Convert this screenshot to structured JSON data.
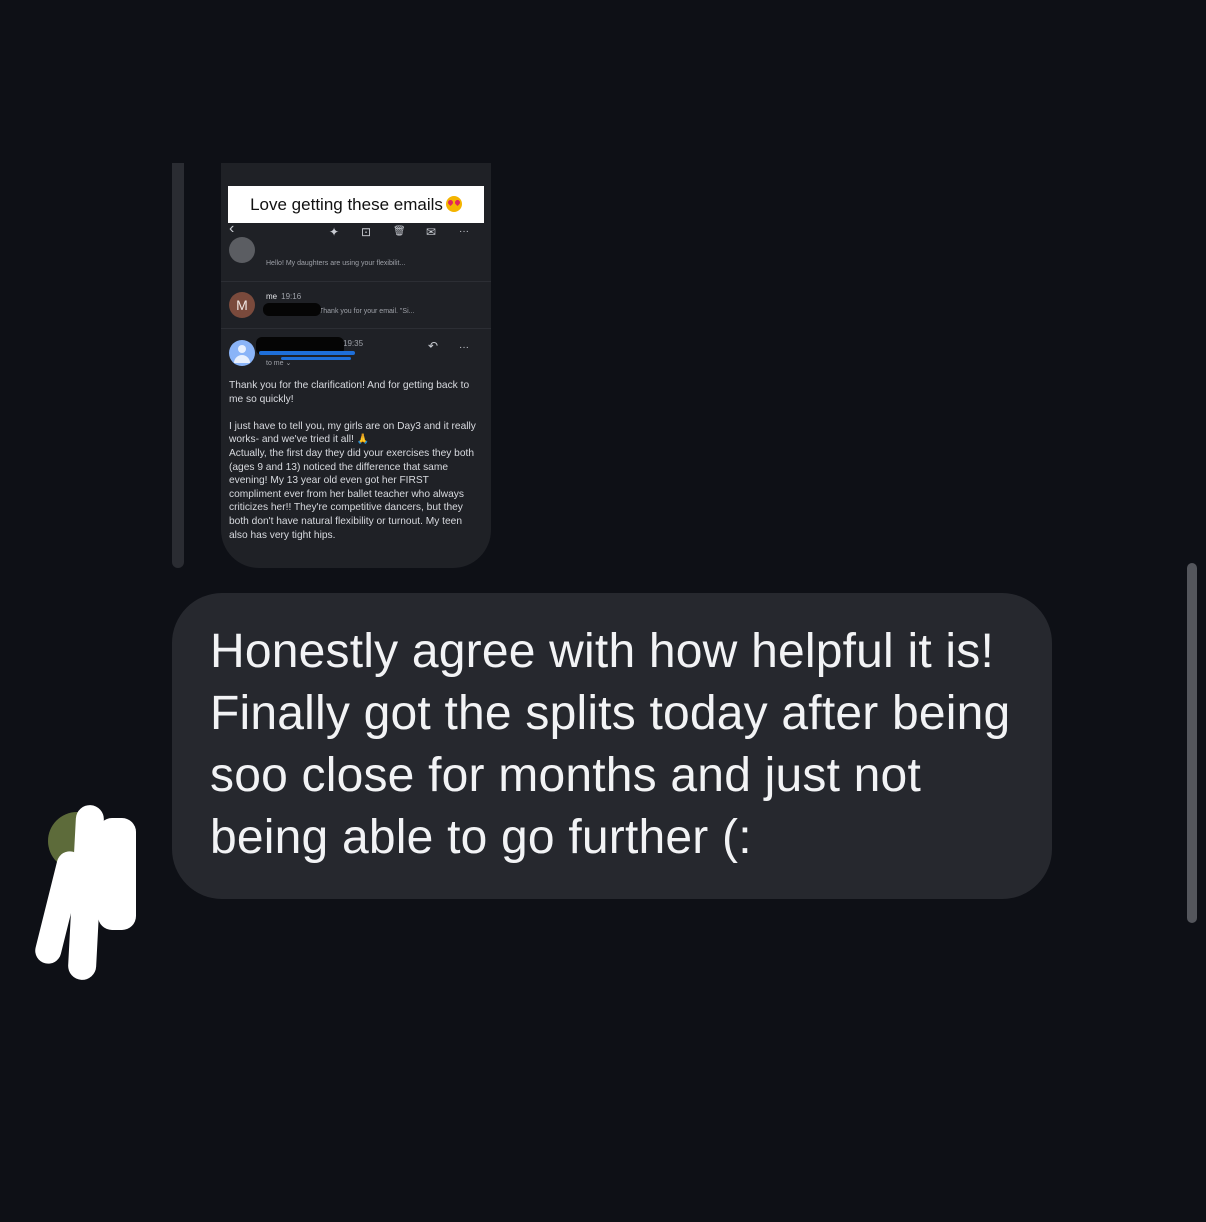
{
  "shared_screenshot": {
    "caption": "Love getting these emails",
    "caption_emoji": "heart-eyes-emoji",
    "toolbar": {
      "back": "‹",
      "sparkle": "✦",
      "archive": "⊡",
      "delete": "🗑",
      "mail": "✉",
      "more": "···"
    },
    "previous_message": {
      "snippet": "Hello! My daughters are using your flexibilit..."
    },
    "my_message": {
      "avatar_letter": "M",
      "sender": "me",
      "time": "19:16",
      "snippet": "Thank you for your email. \"Si..."
    },
    "open_message": {
      "time": "19:35",
      "to": "to me ⌄",
      "reply_icon": "↶",
      "more_icon": "···",
      "paragraph_1": "Thank you for the clarification! And for getting back to me so quickly!",
      "paragraph_2_a": "I just have to tell you, my girls are on Day3 and it really works- and we've tried it all!",
      "paragraph_2_emoji": "🙏",
      "paragraph_2_b": "Actually, the first day they did your exercises they both (ages 9 and 13) noticed the difference that same evening! My 13 year old even got her FIRST compliment ever from her ballet teacher who always criticizes her!! They're competitive dancers, but they both don't have natural flexibility or turnout. My teen also has very tight hips."
    }
  },
  "message": {
    "text": "Honestly agree with how helpful it is! Finally got the splits today after being soo close for months and just not being able to go further (:"
  },
  "colors": {
    "background": "#0e1016",
    "bubble": "#26282e",
    "bubble_text": "#f2f3f5"
  }
}
